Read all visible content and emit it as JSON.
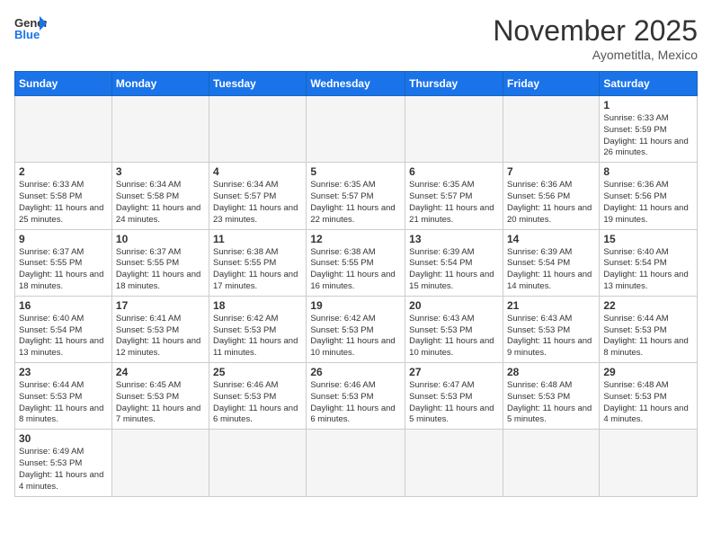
{
  "header": {
    "logo_general": "General",
    "logo_blue": "Blue",
    "month_title": "November 2025",
    "location": "Ayometitla, Mexico"
  },
  "weekdays": [
    "Sunday",
    "Monday",
    "Tuesday",
    "Wednesday",
    "Thursday",
    "Friday",
    "Saturday"
  ],
  "weeks": [
    [
      {
        "day": "",
        "text": "",
        "empty": true
      },
      {
        "day": "",
        "text": "",
        "empty": true
      },
      {
        "day": "",
        "text": "",
        "empty": true
      },
      {
        "day": "",
        "text": "",
        "empty": true
      },
      {
        "day": "",
        "text": "",
        "empty": true
      },
      {
        "day": "",
        "text": "",
        "empty": true
      },
      {
        "day": "1",
        "text": "Sunrise: 6:33 AM\nSunset: 5:59 PM\nDaylight: 11 hours\nand 26 minutes."
      }
    ],
    [
      {
        "day": "2",
        "text": "Sunrise: 6:33 AM\nSunset: 5:58 PM\nDaylight: 11 hours\nand 25 minutes."
      },
      {
        "day": "3",
        "text": "Sunrise: 6:34 AM\nSunset: 5:58 PM\nDaylight: 11 hours\nand 24 minutes."
      },
      {
        "day": "4",
        "text": "Sunrise: 6:34 AM\nSunset: 5:57 PM\nDaylight: 11 hours\nand 23 minutes."
      },
      {
        "day": "5",
        "text": "Sunrise: 6:35 AM\nSunset: 5:57 PM\nDaylight: 11 hours\nand 22 minutes."
      },
      {
        "day": "6",
        "text": "Sunrise: 6:35 AM\nSunset: 5:57 PM\nDaylight: 11 hours\nand 21 minutes."
      },
      {
        "day": "7",
        "text": "Sunrise: 6:36 AM\nSunset: 5:56 PM\nDaylight: 11 hours\nand 20 minutes."
      },
      {
        "day": "8",
        "text": "Sunrise: 6:36 AM\nSunset: 5:56 PM\nDaylight: 11 hours\nand 19 minutes."
      }
    ],
    [
      {
        "day": "9",
        "text": "Sunrise: 6:37 AM\nSunset: 5:55 PM\nDaylight: 11 hours\nand 18 minutes."
      },
      {
        "day": "10",
        "text": "Sunrise: 6:37 AM\nSunset: 5:55 PM\nDaylight: 11 hours\nand 18 minutes."
      },
      {
        "day": "11",
        "text": "Sunrise: 6:38 AM\nSunset: 5:55 PM\nDaylight: 11 hours\nand 17 minutes."
      },
      {
        "day": "12",
        "text": "Sunrise: 6:38 AM\nSunset: 5:55 PM\nDaylight: 11 hours\nand 16 minutes."
      },
      {
        "day": "13",
        "text": "Sunrise: 6:39 AM\nSunset: 5:54 PM\nDaylight: 11 hours\nand 15 minutes."
      },
      {
        "day": "14",
        "text": "Sunrise: 6:39 AM\nSunset: 5:54 PM\nDaylight: 11 hours\nand 14 minutes."
      },
      {
        "day": "15",
        "text": "Sunrise: 6:40 AM\nSunset: 5:54 PM\nDaylight: 11 hours\nand 13 minutes."
      }
    ],
    [
      {
        "day": "16",
        "text": "Sunrise: 6:40 AM\nSunset: 5:54 PM\nDaylight: 11 hours\nand 13 minutes."
      },
      {
        "day": "17",
        "text": "Sunrise: 6:41 AM\nSunset: 5:53 PM\nDaylight: 11 hours\nand 12 minutes."
      },
      {
        "day": "18",
        "text": "Sunrise: 6:42 AM\nSunset: 5:53 PM\nDaylight: 11 hours\nand 11 minutes."
      },
      {
        "day": "19",
        "text": "Sunrise: 6:42 AM\nSunset: 5:53 PM\nDaylight: 11 hours\nand 10 minutes."
      },
      {
        "day": "20",
        "text": "Sunrise: 6:43 AM\nSunset: 5:53 PM\nDaylight: 11 hours\nand 10 minutes."
      },
      {
        "day": "21",
        "text": "Sunrise: 6:43 AM\nSunset: 5:53 PM\nDaylight: 11 hours\nand 9 minutes."
      },
      {
        "day": "22",
        "text": "Sunrise: 6:44 AM\nSunset: 5:53 PM\nDaylight: 11 hours\nand 8 minutes."
      }
    ],
    [
      {
        "day": "23",
        "text": "Sunrise: 6:44 AM\nSunset: 5:53 PM\nDaylight: 11 hours\nand 8 minutes."
      },
      {
        "day": "24",
        "text": "Sunrise: 6:45 AM\nSunset: 5:53 PM\nDaylight: 11 hours\nand 7 minutes."
      },
      {
        "day": "25",
        "text": "Sunrise: 6:46 AM\nSunset: 5:53 PM\nDaylight: 11 hours\nand 6 minutes."
      },
      {
        "day": "26",
        "text": "Sunrise: 6:46 AM\nSunset: 5:53 PM\nDaylight: 11 hours\nand 6 minutes."
      },
      {
        "day": "27",
        "text": "Sunrise: 6:47 AM\nSunset: 5:53 PM\nDaylight: 11 hours\nand 5 minutes."
      },
      {
        "day": "28",
        "text": "Sunrise: 6:48 AM\nSunset: 5:53 PM\nDaylight: 11 hours\nand 5 minutes."
      },
      {
        "day": "29",
        "text": "Sunrise: 6:48 AM\nSunset: 5:53 PM\nDaylight: 11 hours\nand 4 minutes."
      }
    ],
    [
      {
        "day": "30",
        "text": "Sunrise: 6:49 AM\nSunset: 5:53 PM\nDaylight: 11 hours\nand 4 minutes."
      },
      {
        "day": "",
        "text": "",
        "empty": true
      },
      {
        "day": "",
        "text": "",
        "empty": true
      },
      {
        "day": "",
        "text": "",
        "empty": true
      },
      {
        "day": "",
        "text": "",
        "empty": true
      },
      {
        "day": "",
        "text": "",
        "empty": true
      },
      {
        "day": "",
        "text": "",
        "empty": true
      }
    ]
  ]
}
